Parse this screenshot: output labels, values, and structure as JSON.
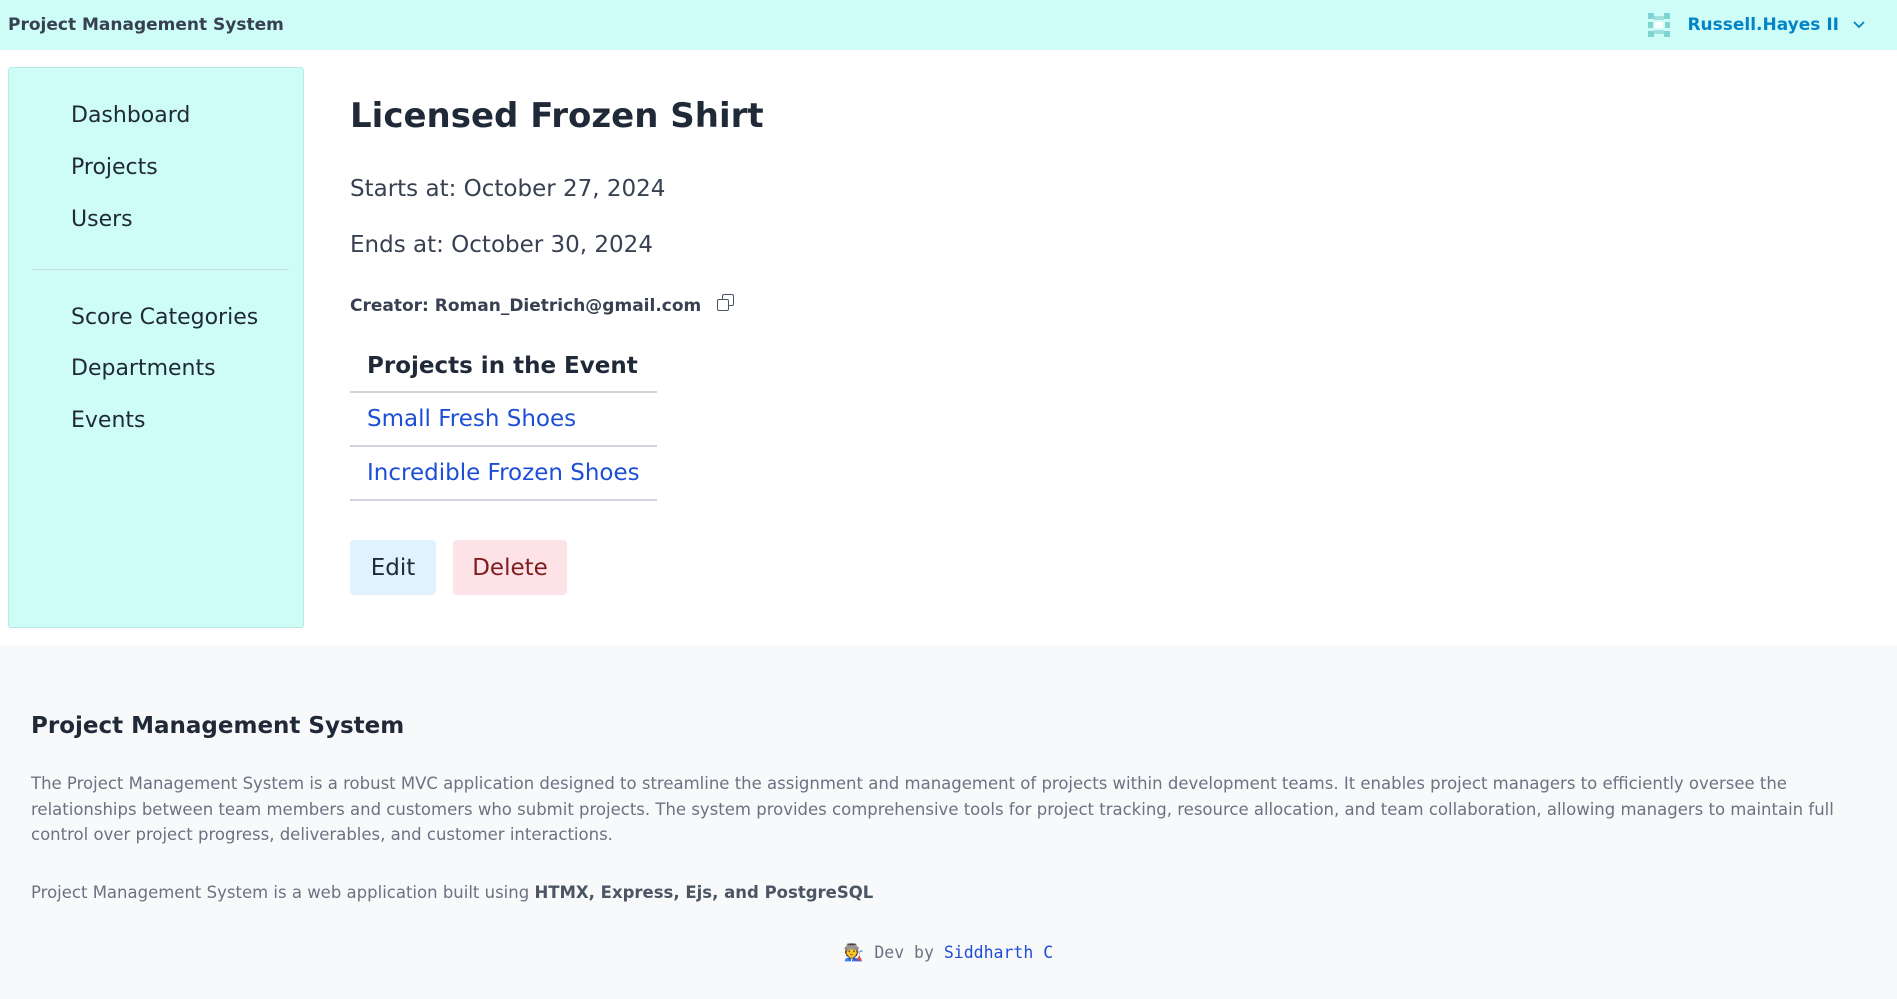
{
  "header": {
    "app_title": "Project Management System",
    "user_name": "Russell.Hayes II",
    "avatar_icon": "pixel-avatar-icon",
    "chevron_icon": "chevron-down-icon"
  },
  "sidebar": {
    "primary_items": [
      {
        "label": "Dashboard"
      },
      {
        "label": "Projects"
      },
      {
        "label": "Users"
      }
    ],
    "secondary_items": [
      {
        "label": "Score Categories"
      },
      {
        "label": "Departments"
      },
      {
        "label": "Events"
      }
    ]
  },
  "event": {
    "title": "Licensed Frozen Shirt",
    "starts_at": "Starts at: October 27, 2024",
    "ends_at": "Ends at: October 30, 2024",
    "creator": "Creator: Roman_Dietrich@gmail.com",
    "copy_icon": "copy-icon",
    "projects_header": "Projects in the Event",
    "projects": [
      {
        "name": "Small Fresh Shoes"
      },
      {
        "name": "Incredible Frozen Shoes"
      }
    ],
    "edit_label": "Edit",
    "delete_label": "Delete"
  },
  "footer": {
    "title": "Project Management System",
    "description": "The Project Management System is a robust MVC application designed to streamline the assignment and management of projects within development teams. It enables project managers to efficiently oversee the relationships between team members and customers who submit projects. The system provides comprehensive tools for project tracking, resource allocation, and team collaboration, allowing managers to maintain full control over project progress, deliverables, and customer interactions.",
    "tech_prefix": "Project Management System is a web application built using ",
    "tech_stack": "HTMX, Express, Ejs, and PostgreSQL",
    "dev_emoji": "🧑‍🏭",
    "dev_text": " Dev by ",
    "dev_name": "Siddharth C"
  },
  "colors": {
    "header_bg": "#cefdf8",
    "sidebar_bg": "#cefdf8",
    "user_accent": "#0284c7",
    "link": "#1d4ed8",
    "edit_bg": "#e0f2fe",
    "delete_bg": "#fde2e8",
    "delete_text": "#7f1d1d",
    "footer_bg": "#f8f9fb"
  }
}
